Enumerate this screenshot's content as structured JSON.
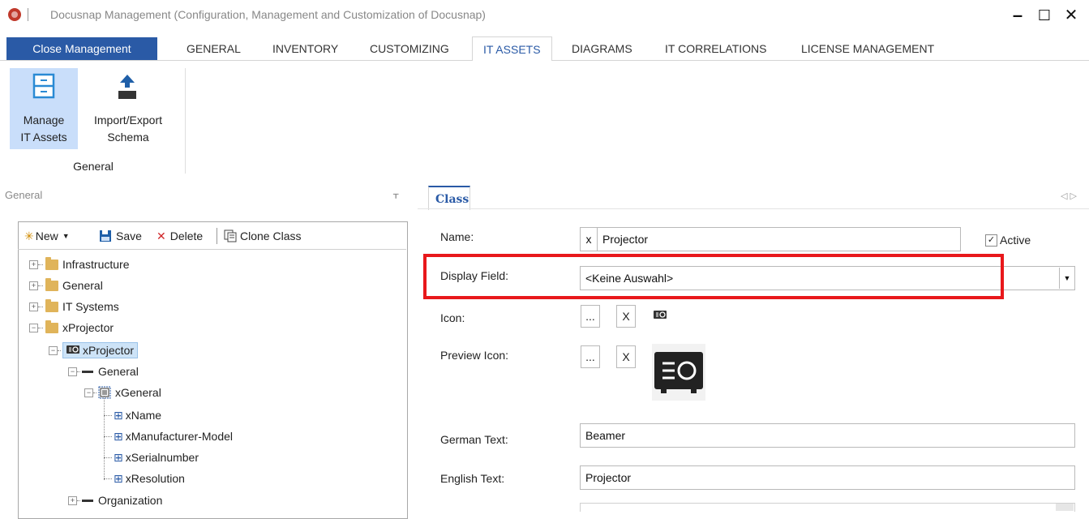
{
  "window": {
    "title": "Docusnap Management (Configuration, Management and Customization of Docusnap)",
    "minimize": "–",
    "maximize": "☐",
    "close": "✕"
  },
  "ribbon": {
    "close_management": "Close Management",
    "tabs": [
      "GENERAL",
      "INVENTORY",
      "CUSTOMIZING",
      "IT ASSETS",
      "DIAGRAMS",
      "IT CORRELATIONS",
      "LICENSE MANAGEMENT"
    ],
    "active_tab": "IT ASSETS",
    "buttons": {
      "manage_line1": "Manage",
      "manage_line2": "IT Assets",
      "import_line1": "Import/Export",
      "import_line2": "Schema"
    },
    "group_label": "General"
  },
  "left_pane": {
    "header": "General",
    "pin": "ᚁ",
    "toolbar": {
      "new": "New",
      "save": "Save",
      "delete": "Delete",
      "clone": "Clone Class"
    },
    "tree": {
      "infrastructure": "Infrastructure",
      "general": "General",
      "it_systems": "IT Systems",
      "xprojector_folder": "xProjector",
      "xprojector_class": "xProjector",
      "general_node": "General",
      "xgeneral": "xGeneral",
      "xname": "xName",
      "xmanufacturer_model": "xManufacturer-Model",
      "xserialnumber": "xSerialnumber",
      "xresolution": "xResolution",
      "organization": "Organization"
    }
  },
  "right_pane": {
    "tab_label": "Class",
    "nav": "◁ ▷",
    "name_label": "Name:",
    "name_prefix": "x",
    "name_value": "Projector",
    "active_label": "Active",
    "active_checked": "✓",
    "display_field_label": "Display Field:",
    "display_field_value": "<Keine Auswahl>",
    "icon_label": "Icon:",
    "preview_icon_label": "Preview Icon:",
    "browse_button": "...",
    "clear_button": "X",
    "german_text_label": "German Text:",
    "german_text_value": "Beamer",
    "english_text_label": "English Text:",
    "english_text_value": "Projector"
  },
  "colors": {
    "accent": "#2a5aa6",
    "highlight": "#e8181b",
    "selected_ribbon": "#c9defa"
  }
}
